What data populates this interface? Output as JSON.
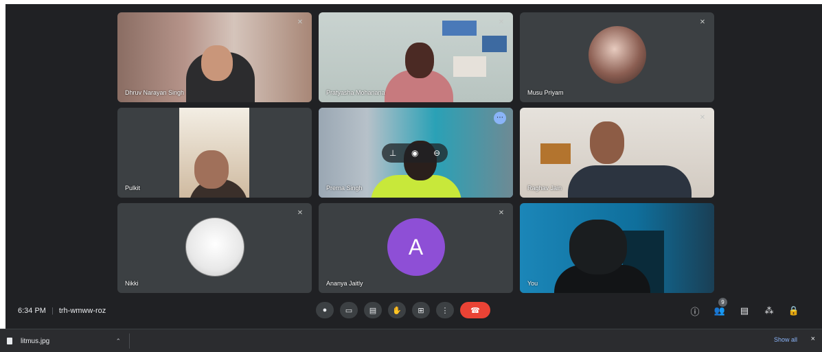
{
  "meeting": {
    "time": "6:34 PM",
    "code": "trh-wmww-roz"
  },
  "participants": [
    {
      "name": "Dhruv Narayan Singh"
    },
    {
      "name": "Pratyasha Mohanana"
    },
    {
      "name": "Musu Priyam"
    },
    {
      "name": "Pulkit"
    },
    {
      "name": "Prerna Singh"
    },
    {
      "name": "Raghav Jain"
    },
    {
      "name": "Nikki"
    },
    {
      "name": "Ananya Jaitly",
      "initial": "A"
    },
    {
      "name": "You"
    }
  ],
  "controls": {
    "mic_icon": "mic-icon",
    "camera_icon": "camera-icon",
    "captions_icon": "captions-icon",
    "raise_hand_icon": "hand-icon",
    "present_icon": "present-icon",
    "more_icon": "more-icon",
    "end_call_icon": "end-call-icon"
  },
  "right_controls": {
    "people_count": "9"
  },
  "download_bar": {
    "file_name": "litmus.jpg",
    "show_all": "Show all",
    "close": "×"
  },
  "colors": {
    "background": "#202124",
    "tile": "#3c4043",
    "end_call": "#ea4335",
    "avatar_purple": "#8e4fd6",
    "active_outline": "#8ab4f8"
  }
}
